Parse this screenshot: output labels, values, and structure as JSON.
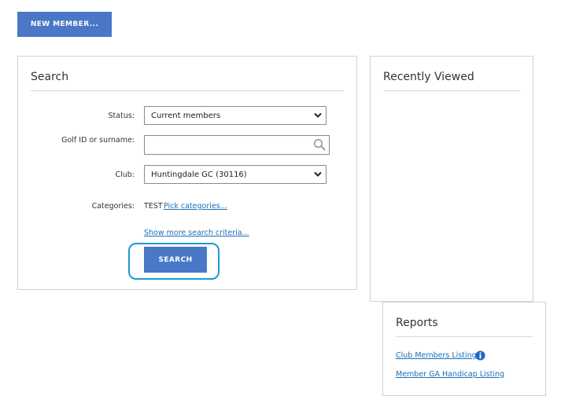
{
  "toolbar": {
    "new_member_label": "NEW MEMBER..."
  },
  "search": {
    "title": "Search",
    "status_label": "Status:",
    "status_value": "Current members",
    "golf_id_label": "Golf ID or surname:",
    "golf_id_value": "",
    "club_label": "Club:",
    "club_value": "Huntingdale GC (30116)",
    "categories_label": "Categories:",
    "categories_value": "TEST",
    "pick_categories_link": "Pick categories...",
    "show_more_link": "Show more search criteria...",
    "search_button": "SEARCH"
  },
  "recently_viewed": {
    "title": "Recently Viewed"
  },
  "reports": {
    "title": "Reports",
    "items": [
      {
        "label": "Club Members Listing",
        "info_icon": "info-circle-icon"
      },
      {
        "label": "Member GA Handicap Listing"
      }
    ]
  },
  "colors": {
    "accent_button": "#4a78c6",
    "highlight_ring": "#1a9ad6",
    "link": "#1a6fb5",
    "panel_border": "#d3d3d3"
  }
}
